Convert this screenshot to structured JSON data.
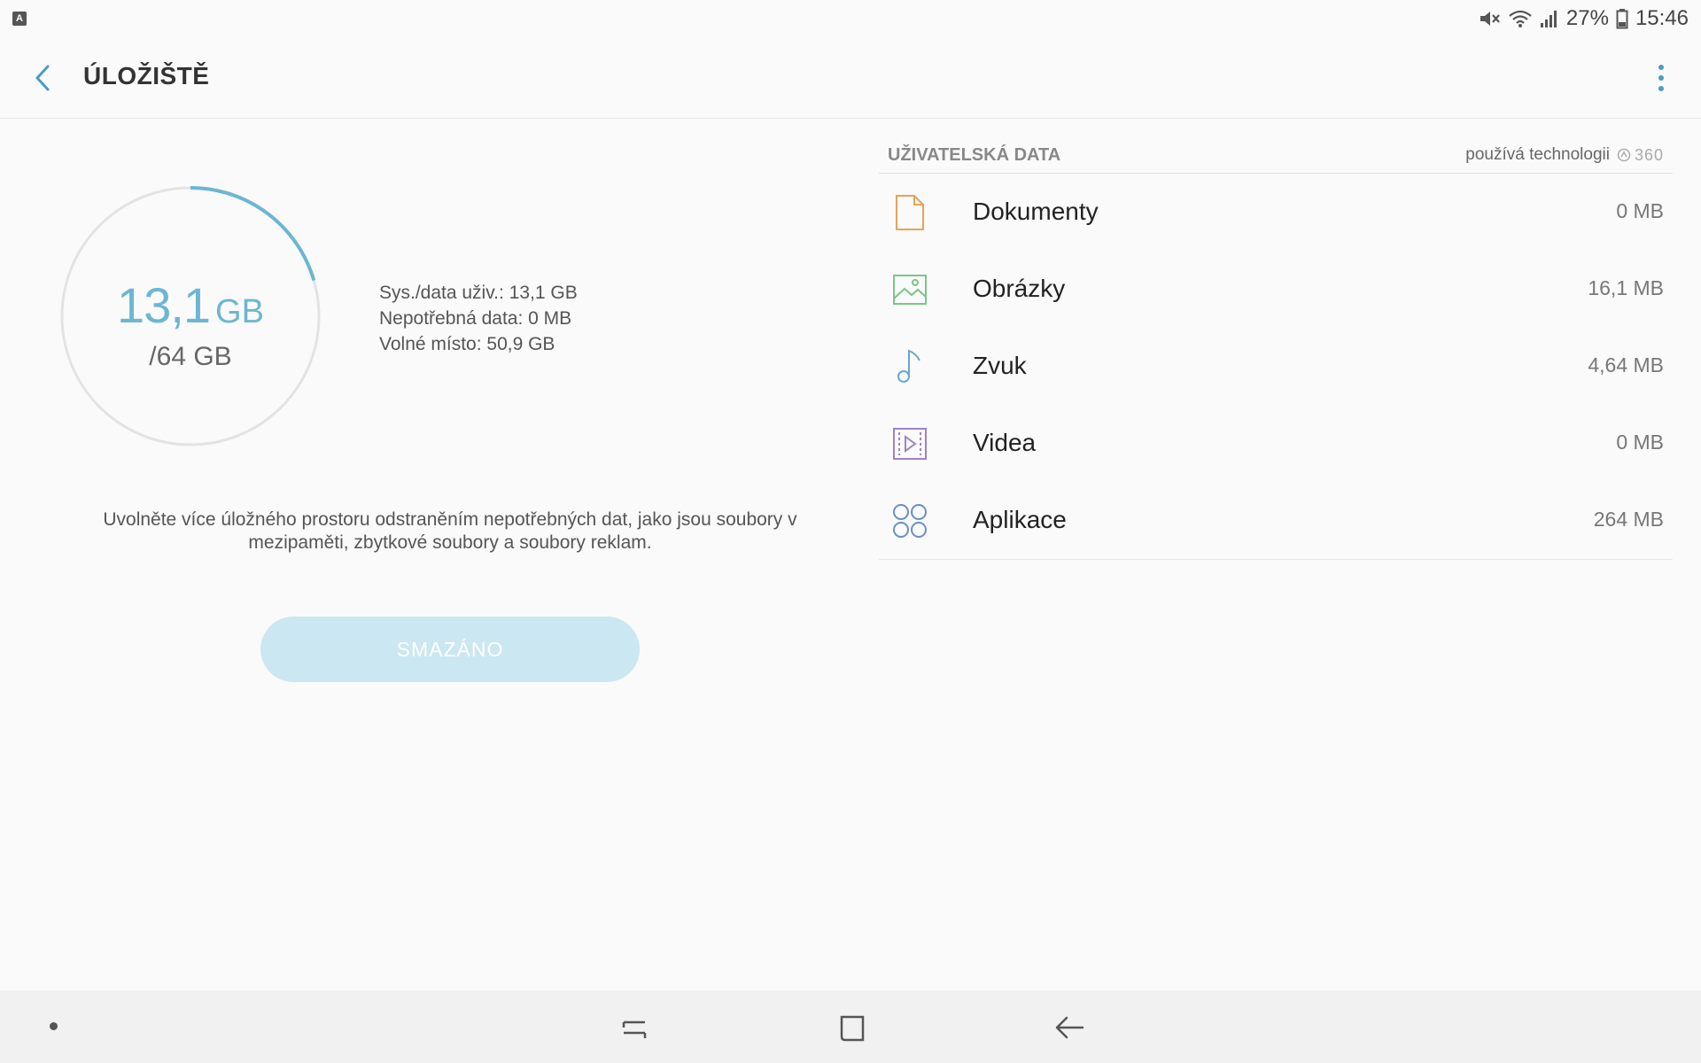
{
  "status_bar": {
    "notification_icon": "a-icon",
    "battery_percent": "27%",
    "time": "15:46"
  },
  "app_bar": {
    "title": "ÚLOŽIŠTĚ"
  },
  "storage": {
    "used_value": "13,1",
    "used_unit": "GB",
    "total": "/64 GB",
    "used_fraction": 0.205,
    "stats": [
      "Sys./data uživ.: 13,1 GB",
      "Nepotřebná data: 0 MB",
      "Volné místo: 50,9 GB"
    ],
    "hint": "Uvolněte více úložného prostoru odstraněním nepotřebných dat, jako jsou soubory v mezipaměti, zbytkové soubory a soubory reklam.",
    "cleanup_button": "SMAZÁNO"
  },
  "user_data": {
    "section_title": "UŽIVATELSKÁ DATA",
    "powered_by": "používá technologii",
    "powered_logo": "360",
    "items": [
      {
        "label": "Dokumenty",
        "size": "0 MB",
        "icon": "document-icon",
        "color": "#e5a35a"
      },
      {
        "label": "Obrázky",
        "size": "16,1 MB",
        "icon": "image-icon",
        "color": "#7cc587"
      },
      {
        "label": "Zvuk",
        "size": "4,64 MB",
        "icon": "music-note-icon",
        "color": "#6aa6cf"
      },
      {
        "label": "Videa",
        "size": "0 MB",
        "icon": "video-icon",
        "color": "#9d82c9"
      },
      {
        "label": "Aplikace",
        "size": "264 MB",
        "icon": "apps-icon",
        "color": "#6a8fc9"
      }
    ]
  },
  "colors": {
    "accent": "#6cb6d2",
    "button_disabled": "#cbe7f1"
  }
}
